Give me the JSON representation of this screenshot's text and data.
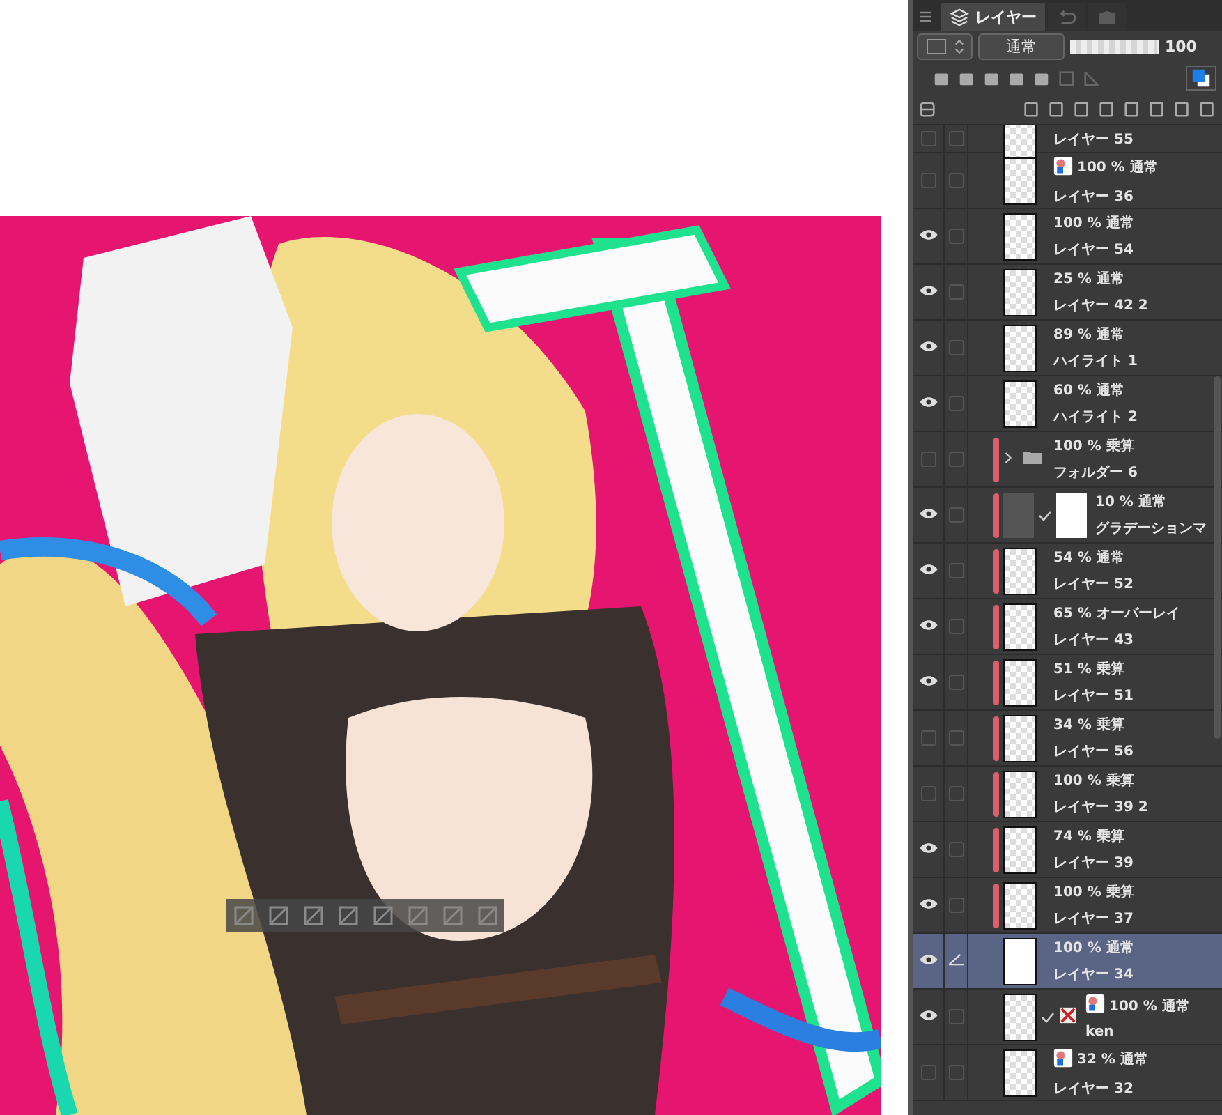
{
  "panel": {
    "tabs": [
      {
        "kind": "layers",
        "label": "レイヤー",
        "selected": true
      },
      {
        "kind": "history",
        "selected": false
      },
      {
        "kind": "navigator",
        "selected": false
      }
    ],
    "blend_mode": "通常",
    "opacity": {
      "level": 1,
      "reading": "100"
    },
    "layers": [
      {
        "kind": "layer",
        "partial": true,
        "name": "レイヤー 55",
        "visible": false,
        "clipped": false,
        "selected": false
      },
      {
        "kind": "reference",
        "info": "100 % 通常",
        "name": "レイヤー 36",
        "visible": false,
        "clipped": false,
        "selected": false
      },
      {
        "kind": "layer",
        "info": "100 % 通常",
        "name": "レイヤー 54",
        "visible": true,
        "clipped": false,
        "selected": false
      },
      {
        "kind": "layer",
        "info": "25 % 通常",
        "name": "レイヤー 42 2",
        "visible": true,
        "clipped": false,
        "selected": false
      },
      {
        "kind": "layer",
        "info": "89 % 通常",
        "name": "ハイライト 1",
        "visible": true,
        "clipped": false,
        "selected": false
      },
      {
        "kind": "layer",
        "info": "60 % 通常",
        "name": "ハイライト 2",
        "visible": true,
        "clipped": false,
        "selected": false
      },
      {
        "kind": "folder",
        "info": "100 % 乗算",
        "name": "フォルダー 6",
        "visible": false,
        "clipped": true,
        "selected": false,
        "expanded": false
      },
      {
        "kind": "gradient",
        "info": "10 % 通常",
        "name": "グラデーションマ",
        "visible": true,
        "clipped": true,
        "selected": false
      },
      {
        "kind": "layer",
        "info": "54 % 通常",
        "name": "レイヤー 52",
        "visible": true,
        "clipped": true,
        "selected": false
      },
      {
        "kind": "layer",
        "info": "65 % オーバーレイ",
        "name": "レイヤー 43",
        "visible": true,
        "clipped": true,
        "selected": false
      },
      {
        "kind": "layer",
        "info": "51 % 乗算",
        "name": "レイヤー 51",
        "visible": true,
        "clipped": true,
        "selected": false
      },
      {
        "kind": "layer",
        "info": "34 % 乗算",
        "name": "レイヤー 56",
        "visible": false,
        "clipped": true,
        "selected": false
      },
      {
        "kind": "layer",
        "info": "100 % 乗算",
        "name": "レイヤー 39 2",
        "visible": false,
        "clipped": true,
        "selected": false
      },
      {
        "kind": "layer",
        "info": "74 % 乗算",
        "name": "レイヤー 39",
        "visible": true,
        "clipped": true,
        "selected": false
      },
      {
        "kind": "layer",
        "info": "100 % 乗算",
        "name": "レイヤー 37",
        "visible": true,
        "clipped": true,
        "selected": false
      },
      {
        "kind": "layer",
        "info": "100 % 通常",
        "name": "レイヤー 34",
        "visible": true,
        "clipped": false,
        "selected": true,
        "editing": true
      },
      {
        "kind": "masked",
        "info": "100 % 通常",
        "name": "ken",
        "visible": true,
        "clipped": false,
        "selected": false
      },
      {
        "kind": "reference",
        "info": "32 % 通常",
        "name": "レイヤー 32",
        "visible": false,
        "clipped": false,
        "selected": false
      }
    ]
  }
}
